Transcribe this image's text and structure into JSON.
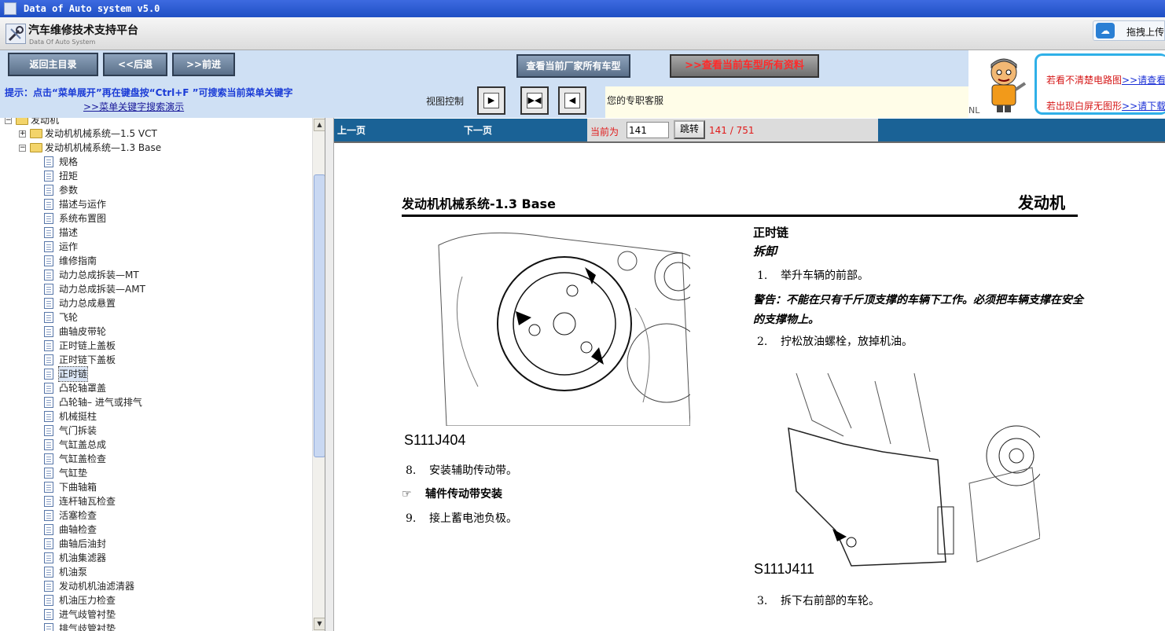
{
  "window": {
    "title": "Data of Auto system v5.0"
  },
  "banner": {
    "brand": "汽车维修技术支持平台",
    "brand_sub": "Data Of Auto System",
    "upload_label": "拖拽上传"
  },
  "toolbar": {
    "home_label": "返回主目录",
    "back_label": "<<后退",
    "forward_label": ">>前进",
    "all_models_label": "查看当前厂家所有车型",
    "all_docs_label": ">>查看当前车型所有资料",
    "hint": "提示：点击“菜单展开”再在键盘按“Ctrl+F ”可搜索当前菜单关键字",
    "demo_link": ">>菜单关键字搜索演示",
    "view_control_label": "视图控制",
    "support_text": "您的专职客服"
  },
  "ad": {
    "nl": "NL",
    "line1_text": "若看不清楚电路图",
    "line1_link": ">>请查看",
    "line2_text": "若出现白屏无图形",
    "line2_link": ">>请下载"
  },
  "tree": {
    "root": "发动机",
    "group1": "发动机机械系统—1.5 VCT",
    "group2": "发动机机械系统—1.3 Base",
    "items": [
      "规格",
      "扭矩",
      "参数",
      "描述与运作",
      "系统布置图",
      "描述",
      "运作",
      "维修指南",
      "动力总成拆装—MT",
      "动力总成拆装—AMT",
      "动力总成悬置",
      "飞轮",
      "曲轴皮带轮",
      "正时链上盖板",
      "正时链下盖板",
      "正时链",
      "凸轮轴罩盖",
      "凸轮轴– 进气或排气",
      "机械挺柱",
      "气门拆装",
      "气缸盖总成",
      "气缸盖检查",
      "气缸垫",
      "下曲轴箱",
      "连杆轴瓦检查",
      "活塞检查",
      "曲轴检查",
      "曲轴后油封",
      "机油集滤器",
      "机油泵",
      "发动机机油滤清器",
      "机油压力检查",
      "进气歧管衬垫",
      "排气歧管衬垫"
    ],
    "selected_index": 15
  },
  "pager": {
    "prev_label": "上一页",
    "next_label": "下一页",
    "current_label": "当前为",
    "current_value": "141",
    "go_label": "跳转",
    "count": "141 / 751"
  },
  "manual": {
    "title": "发动机机械系统-1.3 Base",
    "section": "发动机",
    "fig1_caption": "S111J404",
    "step8": "安装辅助传动带。",
    "step8_num": "8.",
    "sub_heading": "辅件传动带安装",
    "step9": "接上蓄电池负极。",
    "step9_num": "9.",
    "heading_right": "正时链",
    "subheading_right": "拆卸",
    "step1_num": "1.",
    "step1": "举升车辆的前部。",
    "warning": "警告：不能在只有千斤顶支撑的车辆下工作。必须把车辆支撑在安全的支撑物上。",
    "step2_num": "2.",
    "step2": "拧松放油螺栓，放掉机油。",
    "fig2_caption": "S111J411",
    "step3_num": "3.",
    "step3": "拆下右前部的车轮。"
  }
}
